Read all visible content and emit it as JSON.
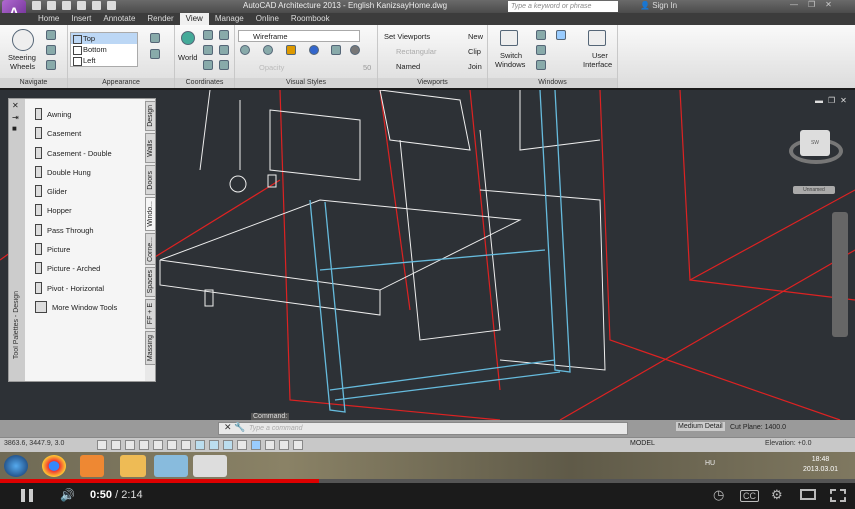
{
  "titlebar": {
    "title": "AutoCAD Architecture 2013 - English   KanizsayHome.dwg",
    "search_placeholder": "Type a keyword or phrase",
    "signin": "Sign In",
    "app_letter": "A"
  },
  "tabs": [
    "Home",
    "Insert",
    "Annotate",
    "Render",
    "View",
    "Manage",
    "Online",
    "Roombook"
  ],
  "active_tab": "View",
  "ribbon": {
    "navigate": {
      "label": "Navigate",
      "steering": "Steering",
      "wheels": "Wheels"
    },
    "appearance": {
      "label": "Appearance",
      "views": [
        "Top",
        "Bottom",
        "Left"
      ]
    },
    "coordinates": {
      "label": "Coordinates",
      "world": "World"
    },
    "visual_styles": {
      "label": "Visual Styles",
      "style": "Wireframe",
      "opacity_label": "Opacity",
      "opacity_value": "50"
    },
    "viewports": {
      "label": "Viewports",
      "set": "Set Viewports",
      "rect": "Rectangular",
      "named": "Named",
      "new": "New",
      "clip": "Clip",
      "join": "Join"
    },
    "windows": {
      "label": "Windows",
      "switch1": "Switch",
      "switch2": "Windows",
      "ui1": "User",
      "ui2": "Interface"
    }
  },
  "palette": {
    "title": "Tool Palettes - Design",
    "items": [
      "Awning",
      "Casement",
      "Casement - Double",
      "Double Hung",
      "Glider",
      "Hopper",
      "Pass Through",
      "Picture",
      "Picture - Arched",
      "Pivot - Horizontal",
      "More Window Tools"
    ],
    "tabs": [
      "Design",
      "Walls",
      "Doors",
      "Windo...",
      "Corne...",
      "Spaces",
      "FF + E",
      "Massing"
    ],
    "active_tab": "Windo..."
  },
  "viewcube": {
    "label": "SW",
    "unnamed": "Unnamed"
  },
  "command": {
    "label": "Command:",
    "placeholder": "Type a command"
  },
  "status": {
    "coords": "3863.6, 3447.9, 3.0",
    "model": "MODEL",
    "detail": "Medium Detail",
    "cut_plane": "Cut Plane: 1400.0",
    "elevation": "Elevation: +0.0"
  },
  "taskbar": {
    "lang": "HU",
    "time": "18:48",
    "date": "2013.03.01"
  },
  "player": {
    "current": "0:50",
    "duration": "/ 2:14",
    "progress": 0.373
  }
}
